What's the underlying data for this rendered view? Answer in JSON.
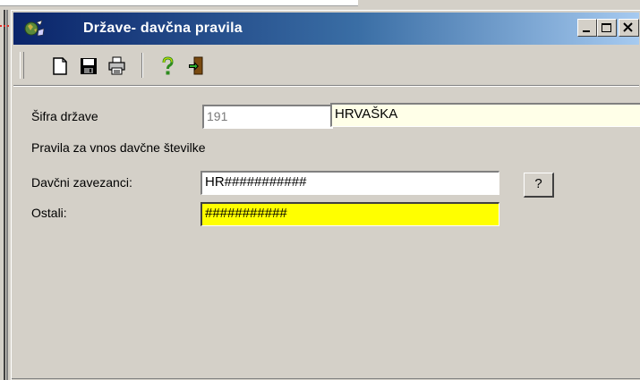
{
  "window": {
    "title": "Države- davčna pravila"
  },
  "toolbar": {
    "buttons": [
      {
        "name": "new-document-icon"
      },
      {
        "name": "save-disk-icon"
      },
      {
        "name": "print-icon"
      },
      {
        "name": "help-question-icon"
      },
      {
        "name": "exit-door-icon"
      }
    ]
  },
  "form": {
    "country_code_label": "Šifra države",
    "country_code_value": "191",
    "country_name_value": "HRVAŠKA",
    "rules_heading": "Pravila za vnos davčne številke",
    "taxpayers_label": "Davčni zavezanci:",
    "taxpayers_value": "HR###########",
    "others_label": "Ostali:",
    "others_value": "###########",
    "help_button_label": "?"
  },
  "colors": {
    "title_gradient_start": "#0a246a",
    "title_gradient_end": "#a6caf0",
    "highlight_field": "#ffff00",
    "name_field": "#ffffe8",
    "required_arrow": "#e0101a"
  }
}
